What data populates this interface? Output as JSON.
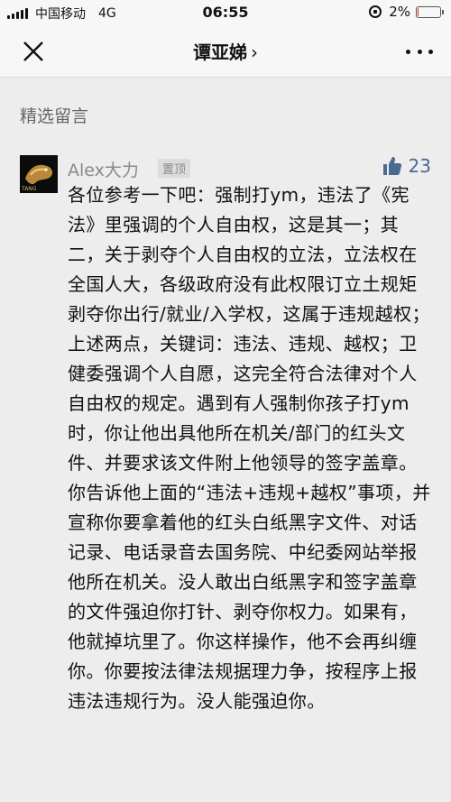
{
  "status_bar": {
    "carrier": "中国移动",
    "network": "4G",
    "time": "06:55",
    "battery_percent": "2%",
    "battery_level": 0.02,
    "battery_color": "#e0301e"
  },
  "nav": {
    "close_icon": "close-icon",
    "title": "谭亚娣",
    "title_chevron": "›",
    "more_icon": "more-icon"
  },
  "section": {
    "title": "精选留言"
  },
  "comment": {
    "avatar_text": "TANG",
    "author": "Alex大力",
    "badge": "置顶",
    "like_icon": "thumbs-up-icon",
    "like_color": "#4a6a93",
    "likes": "23",
    "text": "各位参考一下吧：强制打ym，违法了《宪法》里强调的个人自由权，这是其一；其二，关于剥夺个人自由权的立法，立法权在全国人大，各级政府没有此权限订立土规矩剥夺你出行/就业/入学权，这属于违规越权；上述两点，关键词：违法、违规、越权；卫健委强调个人自愿，这完全符合法律对个人自由权的规定。遇到有人强制你孩子打ym时，你让他出具他所在机关/部门的红头文件、并要求该文件附上他领导的签字盖章。你告诉他上面的“违法+违规+越权”事项，并宣称你要拿着他的红头白纸黑字文件、对话记录、电话录音去国务院、中纪委网站举报他所在机关。没人敢出白纸黑字和签字盖章的文件强迫你打针、剥夺你权力。如果有，他就掉坑里了。你这样操作，他不会再纠缠你。你要按法律法规据理力争，按程序上报违法违规行为。没人能强迫你。"
  }
}
